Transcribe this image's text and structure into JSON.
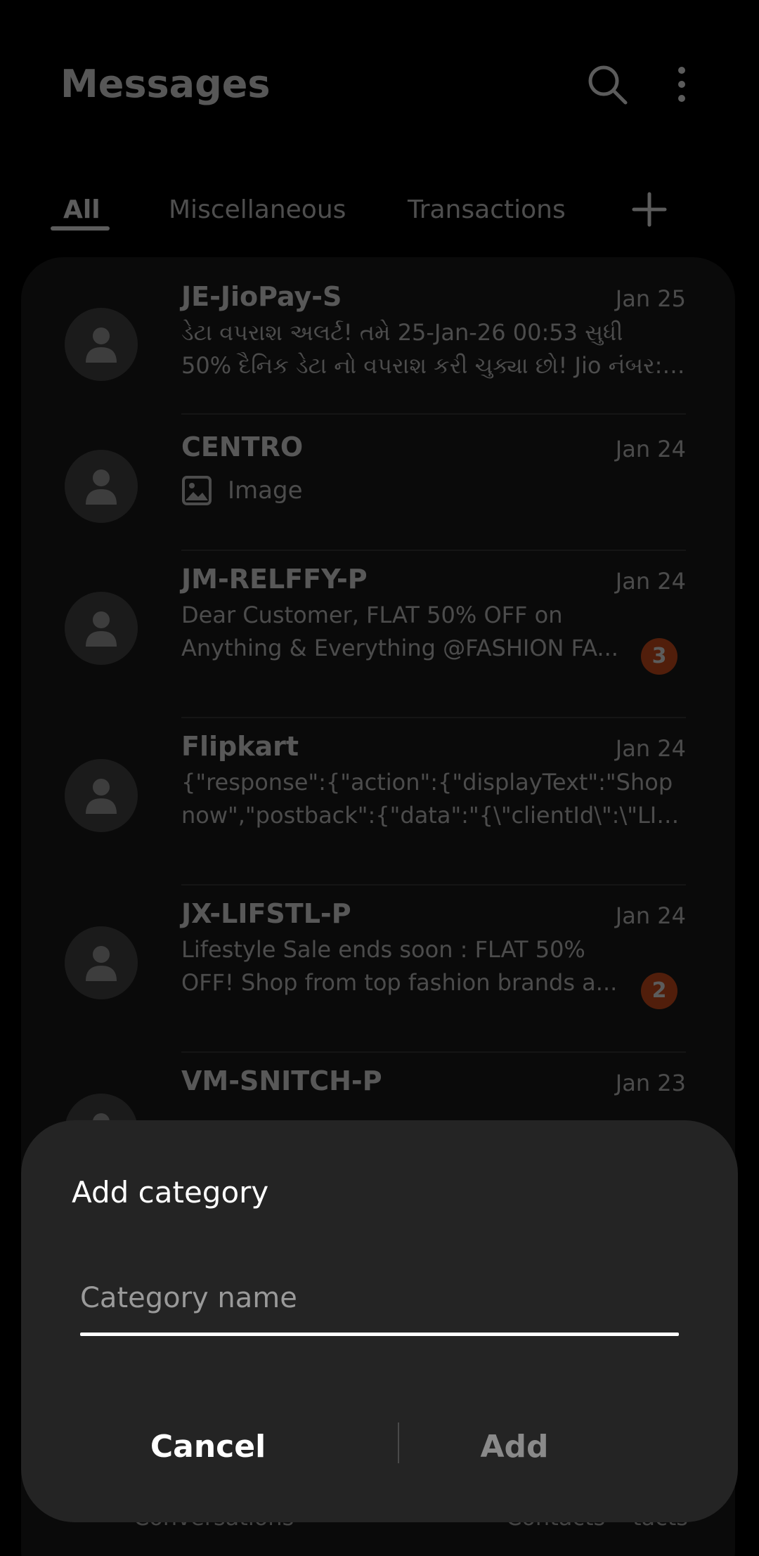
{
  "header": {
    "title": "Messages",
    "search_icon": "search-icon",
    "more_icon": "more-vertical-icon"
  },
  "tabs": [
    {
      "label": "All",
      "active": true
    },
    {
      "label": "Miscellaneous",
      "active": false
    },
    {
      "label": "Transactions",
      "active": false
    }
  ],
  "add_tab_icon": "plus-icon",
  "conversations": [
    {
      "sender": "JE-JioPay-S",
      "date": "Jan 25",
      "preview_lines": [
        "ડેટા વપરાશ અલર્ટ! તમે 25-Jan-26 00:53 સુધી",
        "50% દૈનિક ડેટા નો વપરાશ કરી ચુક્યા છો! Jio નંબર: ..."
      ]
    },
    {
      "sender": "CENTRO",
      "date": "Jan 24",
      "attachment_label": "Image",
      "attachment_icon": "image-icon"
    },
    {
      "sender": "JM-RELFFY-P",
      "date": "Jan 24",
      "preview_lines": [
        "Dear Customer, FLAT 50% OFF on",
        "Anything & Everything @FASHION FA..."
      ],
      "unread": "3"
    },
    {
      "sender": "Flipkart",
      "date": "Jan 24",
      "preview_lines": [
        "{\"response\":{\"action\":{\"displayText\":\"Shop",
        "now\",\"postback\":{\"data\":\"{\\\"clientId\\\":\\\"LIN5..."
      ]
    },
    {
      "sender": "JX-LIFSTL-P",
      "date": "Jan 24",
      "preview_lines": [
        "Lifestyle Sale ends soon : FLAT 50%",
        "OFF!  Shop from top fashion brands a..."
      ],
      "unread": "2"
    },
    {
      "sender": "VM-SNITCH-P",
      "date": "Jan 23"
    }
  ],
  "bottom_nav": {
    "conversations": "Conversations",
    "contacts": "Contacts",
    "third": "tacts"
  },
  "dialog": {
    "title": "Add category",
    "input_placeholder": "Category name",
    "input_value": "",
    "cancel_label": "Cancel",
    "add_label": "Add"
  },
  "colors": {
    "badge": "#e0541f",
    "dialog_bg": "#242424",
    "card_bg": "#1c1c1c"
  }
}
